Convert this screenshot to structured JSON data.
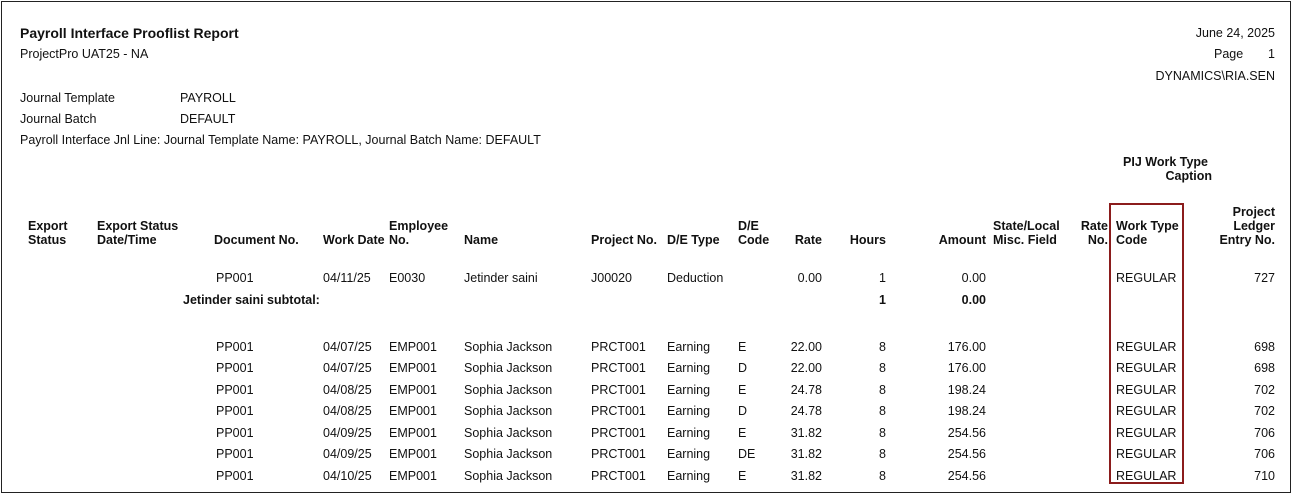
{
  "report": {
    "title": "Payroll Interface Prooflist Report",
    "subtitle": "ProjectPro UAT25 - NA",
    "date": "June 24, 2025",
    "page_label": "Page",
    "page_number": "1",
    "user": "DYNAMICS\\RIA.SEN"
  },
  "filters": {
    "journal_template_label": "Journal Template",
    "journal_template_value": "PAYROLL",
    "journal_batch_label": "Journal Batch",
    "journal_batch_value": "DEFAULT",
    "filter_line": "Payroll Interface Jnl Line: Journal Template Name: PAYROLL, Journal Batch Name: DEFAULT"
  },
  "caption": {
    "line1": "PIJ Work Type",
    "line2": "Caption"
  },
  "columns": {
    "export_status_1": "Export",
    "export_status_2": "Status",
    "export_dt_1": "Export Status",
    "export_dt_2": "Date/Time",
    "document_no": "Document No.",
    "work_date": "Work Date",
    "employee_1": "Employee",
    "employee_2": "No.",
    "name": "Name",
    "project_no": "Project No.",
    "de_type": "D/E Type",
    "de_code_1": "D/E",
    "de_code_2": "Code",
    "rate": "Rate",
    "hours": "Hours",
    "amount": "Amount",
    "state_1": "State/Local",
    "state_2": "Misc. Field",
    "rate_no_1": "Rate",
    "rate_no_2": "No.",
    "work_type_1": "Work Type",
    "work_type_2": "Code",
    "ple_1": "Project",
    "ple_2": "Ledger",
    "ple_3": "Entry No."
  },
  "group1": {
    "rows": [
      {
        "doc": "PP001",
        "date": "04/11/25",
        "emp": "E0030",
        "name": "Jetinder saini",
        "proj": "J00020",
        "type": "Deduction",
        "code": "",
        "rate": "0.00",
        "hours": "1",
        "amount": "0.00",
        "wtc": "REGULAR",
        "ple": "727"
      }
    ],
    "subtotal_label": "Jetinder saini subtotal:",
    "subtotal_hours": "1",
    "subtotal_amount": "0.00"
  },
  "group2": {
    "rows": [
      {
        "doc": "PP001",
        "date": "04/07/25",
        "emp": "EMP001",
        "name": "Sophia Jackson",
        "proj": "PRCT001",
        "type": "Earning",
        "code": "E",
        "rate": "22.00",
        "hours": "8",
        "amount": "176.00",
        "wtc": "REGULAR",
        "ple": "698"
      },
      {
        "doc": "PP001",
        "date": "04/07/25",
        "emp": "EMP001",
        "name": "Sophia Jackson",
        "proj": "PRCT001",
        "type": "Earning",
        "code": "D",
        "rate": "22.00",
        "hours": "8",
        "amount": "176.00",
        "wtc": "REGULAR",
        "ple": "698"
      },
      {
        "doc": "PP001",
        "date": "04/08/25",
        "emp": "EMP001",
        "name": "Sophia Jackson",
        "proj": "PRCT001",
        "type": "Earning",
        "code": "E",
        "rate": "24.78",
        "hours": "8",
        "amount": "198.24",
        "wtc": "REGULAR",
        "ple": "702"
      },
      {
        "doc": "PP001",
        "date": "04/08/25",
        "emp": "EMP001",
        "name": "Sophia Jackson",
        "proj": "PRCT001",
        "type": "Earning",
        "code": "D",
        "rate": "24.78",
        "hours": "8",
        "amount": "198.24",
        "wtc": "REGULAR",
        "ple": "702"
      },
      {
        "doc": "PP001",
        "date": "04/09/25",
        "emp": "EMP001",
        "name": "Sophia Jackson",
        "proj": "PRCT001",
        "type": "Earning",
        "code": "E",
        "rate": "31.82",
        "hours": "8",
        "amount": "254.56",
        "wtc": "REGULAR",
        "ple": "706"
      },
      {
        "doc": "PP001",
        "date": "04/09/25",
        "emp": "EMP001",
        "name": "Sophia Jackson",
        "proj": "PRCT001",
        "type": "Earning",
        "code": "DE",
        "rate": "31.82",
        "hours": "8",
        "amount": "254.56",
        "wtc": "REGULAR",
        "ple": "706"
      },
      {
        "doc": "PP001",
        "date": "04/10/25",
        "emp": "EMP001",
        "name": "Sophia Jackson",
        "proj": "PRCT001",
        "type": "Earning",
        "code": "E",
        "rate": "31.82",
        "hours": "8",
        "amount": "254.56",
        "wtc": "REGULAR",
        "ple": "710"
      }
    ]
  },
  "colors": {
    "highlight_border": "#8b1c1c"
  }
}
